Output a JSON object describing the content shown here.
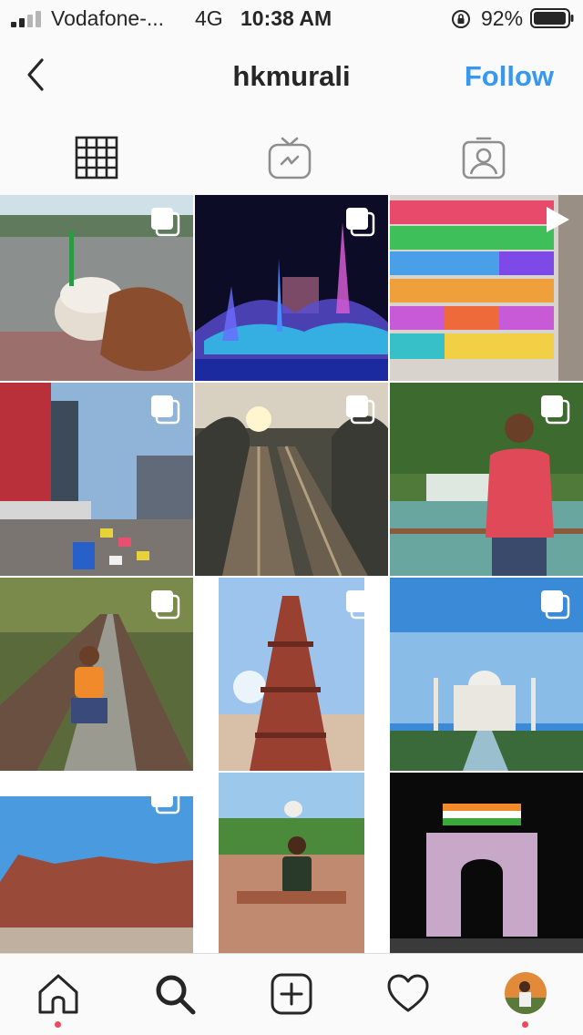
{
  "status_bar": {
    "carrier": "Vodafone-...",
    "network": "4G",
    "time": "10:38 AM",
    "battery_percent": "92%"
  },
  "header": {
    "title": "hkmurali",
    "follow_label": "Follow",
    "back_icon": "chevron-left-icon"
  },
  "tabs": [
    {
      "name": "grid",
      "icon": "grid-icon",
      "active": true
    },
    {
      "name": "igtv",
      "icon": "igtv-icon",
      "active": false
    },
    {
      "name": "tagged",
      "icon": "tagged-user-icon",
      "active": false
    }
  ],
  "posts": [
    {
      "subject": "ice cream in hand on street",
      "badge": "multiple"
    },
    {
      "subject": "illuminated fountain show at night",
      "badge": "multiple"
    },
    {
      "subject": "rows of colorful pens",
      "badge": "video"
    },
    {
      "subject": "city street with traffic and buildings",
      "badge": "multiple"
    },
    {
      "subject": "railway bridge at sunset",
      "badge": "multiple"
    },
    {
      "subject": "man standing by waterfall",
      "badge": "multiple"
    },
    {
      "subject": "man sitting on railway tracks",
      "badge": "multiple"
    },
    {
      "subject": "Qutub Minar tower",
      "badge": "multiple"
    },
    {
      "subject": "Taj Mahal",
      "badge": "multiple"
    },
    {
      "subject": "Red Fort walls",
      "badge": "multiple"
    },
    {
      "subject": "man sitting on bench at Taj Mahal",
      "badge": "none"
    },
    {
      "subject": "India Gate at night",
      "badge": "none"
    }
  ],
  "bottom_nav": [
    {
      "name": "home",
      "icon": "home-icon",
      "notification_dot": true
    },
    {
      "name": "search",
      "icon": "search-icon",
      "notification_dot": false
    },
    {
      "name": "new-post",
      "icon": "add-post-icon",
      "notification_dot": false
    },
    {
      "name": "activity",
      "icon": "heart-icon",
      "notification_dot": false
    },
    {
      "name": "profile",
      "icon": "avatar",
      "notification_dot": true
    }
  ],
  "colors": {
    "accent": "#3897f0",
    "text": "#262626",
    "notification": "#ed4956",
    "background": "#fafafa"
  }
}
